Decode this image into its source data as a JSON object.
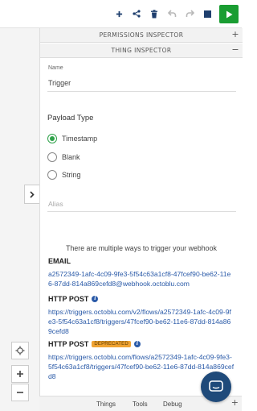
{
  "toolbar": {
    "icons": [
      "plus-icon",
      "share-icon",
      "trash-icon",
      "undo-icon",
      "redo-icon",
      "stop-icon",
      "play-icon"
    ],
    "accent": "#1a9d32"
  },
  "panel": {
    "permissions_inspector": "PERMISSIONS INSPECTOR",
    "thing_inspector": "THING INSPECTOR",
    "name_label": "Name",
    "name_value": "Trigger",
    "payload_type_title": "Payload Type",
    "payload_options": [
      {
        "label": "Timestamp",
        "selected": true
      },
      {
        "label": "Blank",
        "selected": false
      },
      {
        "label": "String",
        "selected": false
      }
    ],
    "alias_placeholder": "Alias",
    "multi_ways_text": "There are multiple ways to trigger your webhook",
    "email_title": "EMAIL",
    "email_value": "a2572349-1afc-4c09-9fe3-5f54c63a1cf8-47fcef90-be62-11e6-87dd-814a869cefd8@webhook.octoblu.com",
    "http_post_title": "HTTP POST",
    "http_post_value": "https://triggers.octoblu.com/v2/flows/a2572349-1afc-4c09-9fe3-5f54c63a1cf8/triggers/47fcef90-be62-11e6-87dd-814a869cefd8",
    "http_post_deprecated_title": "HTTP POST",
    "deprecated_badge": "DEPRECATED",
    "http_post_deprecated_value": "https://triggers.octoblu.com/flows/a2572349-1afc-4c09-9fe3-5f54c63a1cf8/triggers/47fcef90-be62-11e6-87dd-814a869cefd8"
  },
  "bottom_tabs": [
    "Things",
    "Tools",
    "Debug"
  ],
  "colors": {
    "link": "#2a5aa8",
    "radio_selected": "#2fa24a",
    "badge": "#f0a332",
    "chat_button": "#1f4a7a"
  }
}
